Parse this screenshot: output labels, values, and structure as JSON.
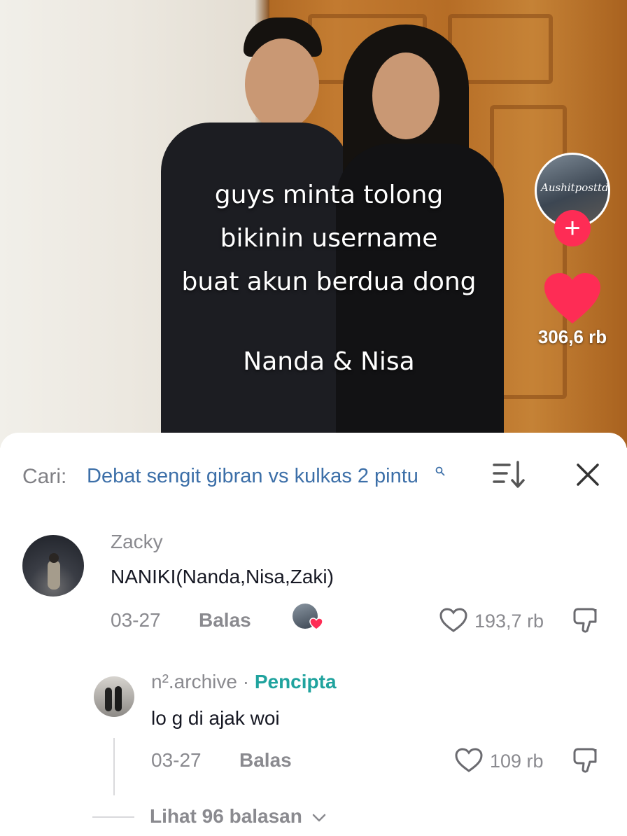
{
  "video": {
    "caption_lines": [
      "guys minta tolong",
      "bikinin username",
      "buat akun berdua dong"
    ],
    "caption_names": "Nanda & Nisa",
    "creator_avatar_watermark": "Aushitposttd",
    "like_count": "306,6 rb",
    "colors": {
      "like": "#fe2c55",
      "follow": "#fe2c55"
    }
  },
  "search": {
    "prefix": "Cari:",
    "query": "Debat sengit gibran vs kulkas 2 pintu"
  },
  "comments": [
    {
      "username": "Zacky",
      "text": "NANIKI(Nanda,Nisa,Zaki)",
      "date": "03-27",
      "reply_label": "Balas",
      "likes": "193,7 rb"
    }
  ],
  "reply": {
    "username": "n².archive",
    "separator": " · ",
    "badge": "Pencipta",
    "text": "lo g di ajak woi",
    "date": "03-27",
    "reply_label": "Balas",
    "likes": "109 rb"
  },
  "view_more": "Lihat 96 balasan",
  "icons": [
    "search-icon",
    "sort-icon",
    "close-icon",
    "heart-outline-icon",
    "dislike-icon",
    "chevron-down-icon",
    "plus-icon",
    "heart-icon"
  ]
}
